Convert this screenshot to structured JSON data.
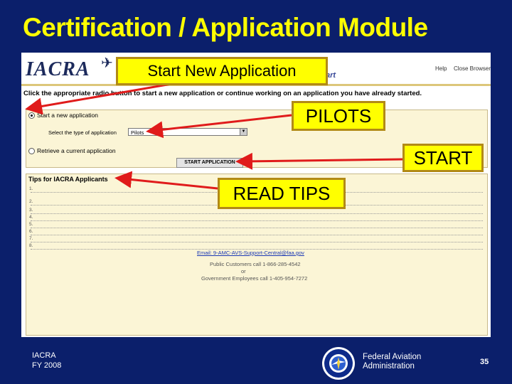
{
  "slide": {
    "title": "Certification / Application Module",
    "footer_org": "IACRA",
    "footer_year": "FY 2008",
    "agency_line1": "Federal Aviation",
    "agency_line2": "Administration",
    "page_number": "35",
    "colors": {
      "background": "#0b1f6b",
      "title": "#ffff00",
      "callout": "#ffff00",
      "arrow": "#e01b1b"
    }
  },
  "screenshot": {
    "logo_text": "IACRA",
    "header_links": [
      "Help",
      "Close Browser"
    ],
    "header_title_fragment": "art",
    "instruction": "Click the appropriate radio button to start a new application or continue working on an application you have already started.",
    "option_new": "Start a new application",
    "select_label": "Select the type of application",
    "select_value": "Pilots",
    "option_retrieve": "Retrieve a current application",
    "start_button_label": "START APPLICATION",
    "tips_title": "Tips for IACRA Applicants",
    "tip_numbers": [
      "1.",
      "2.",
      "3.",
      "4.",
      "5.",
      "6.",
      "7.",
      "8."
    ],
    "contact_email": "Email: 9-AMC-AVS-Support-Central@faa.gov",
    "contact_public": "Public Customers call 1-866-285-4542",
    "contact_or": "or",
    "contact_gov": "Government Employees call 1-405-954-7272"
  },
  "callouts": {
    "start_new": "Start New Application",
    "pilots": "PILOTS",
    "start": "START",
    "read_tips": "READ TIPS"
  },
  "icons": [
    "airplane-icon",
    "dropdown-arrow-icon",
    "faa-seal-icon"
  ]
}
